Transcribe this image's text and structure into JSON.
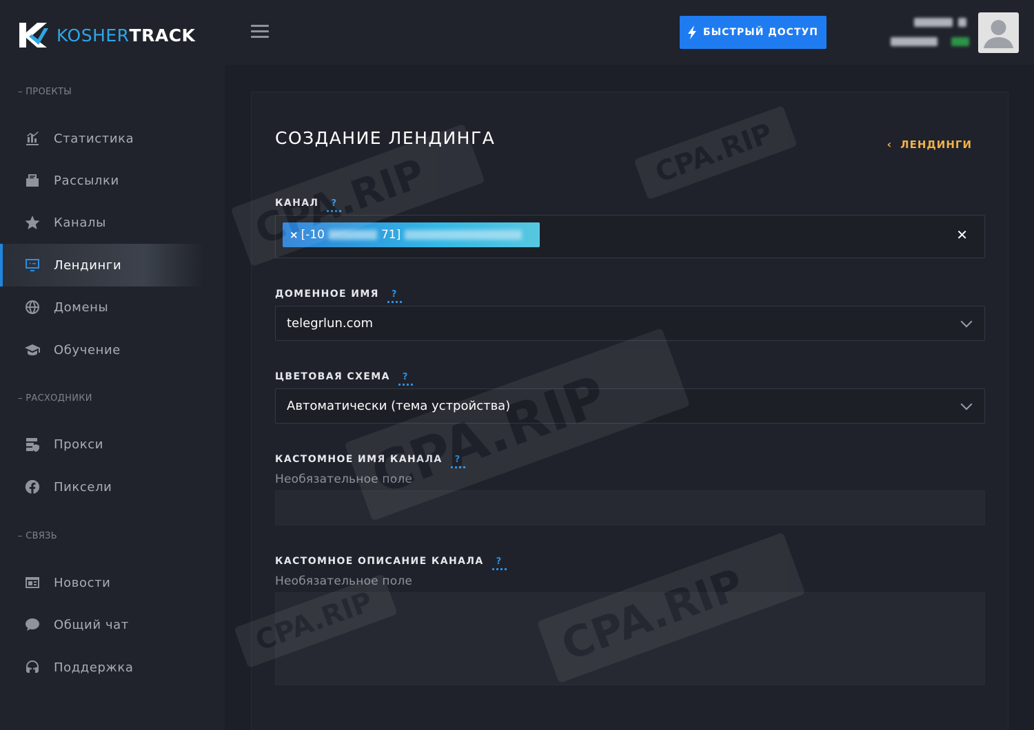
{
  "brand": {
    "name_part1": "KOSHER",
    "name_part2": "TRACK"
  },
  "sidebar": {
    "sections": [
      {
        "title": "– ПРОЕКТЫ"
      },
      {
        "title": "– РАСХОДНИКИ"
      },
      {
        "title": "– СВЯЗЬ"
      }
    ],
    "items": [
      {
        "label": "Статистика",
        "icon": "chart-icon"
      },
      {
        "label": "Рассылки",
        "icon": "mailbox-icon"
      },
      {
        "label": "Каналы",
        "icon": "star-icon"
      },
      {
        "label": "Лендинги",
        "icon": "monitor-icon",
        "active": true
      },
      {
        "label": "Домены",
        "icon": "globe-icon"
      },
      {
        "label": "Обучение",
        "icon": "graduation-cap-icon"
      },
      {
        "label": "Прокси",
        "icon": "server-shield-icon"
      },
      {
        "label": "Пиксели",
        "icon": "facebook-icon"
      },
      {
        "label": "Новости",
        "icon": "newspaper-icon"
      },
      {
        "label": "Общий чат",
        "icon": "chat-bubble-icon"
      },
      {
        "label": "Поддержка",
        "icon": "headset-icon"
      }
    ]
  },
  "topbar": {
    "quick_access_label": "БЫСТРЫЙ ДОСТУП"
  },
  "page": {
    "title": "СОЗДАНИЕ ЛЕНДИНГА",
    "back_link": "ЛЕНДИНГИ"
  },
  "form": {
    "help_symbol": "?",
    "channel": {
      "label": "КАНАЛ",
      "tag_prefix": "[-10",
      "tag_mid": "71]",
      "tag_remove": "×",
      "clear": "✕"
    },
    "domain": {
      "label": "ДОМЕННОЕ ИМЯ",
      "value": "telegrlun.com"
    },
    "color_scheme": {
      "label": "ЦВЕТОВАЯ СХЕМА",
      "value": "Автоматически (тема устройства)"
    },
    "custom_name": {
      "label": "КАСТОМНОЕ ИМЯ КАНАЛА",
      "hint": "Необязательное поле",
      "value": ""
    },
    "custom_desc": {
      "label": "КАСТОМНОЕ ОПИСАНИЕ КАНАЛА",
      "hint": "Необязательное поле",
      "value": ""
    }
  },
  "watermark": {
    "text": "CPA.RIP"
  },
  "colors": {
    "accent": "#1f7cf0",
    "active_border": "#1f86e0",
    "link": "#f1b04a",
    "help": "#2b8fe3"
  }
}
